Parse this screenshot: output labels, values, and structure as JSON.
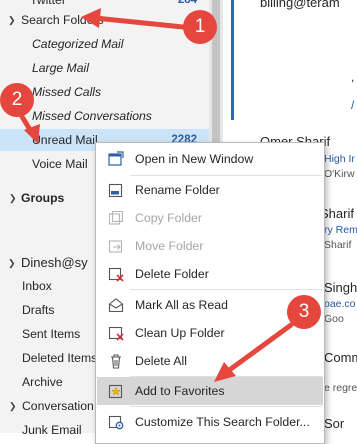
{
  "sidebar": {
    "top_partial": "Twitter",
    "top_partial_count": "284",
    "search_folders": "Search Folders",
    "categorized_mail": "Categorized Mail",
    "large_mail": "Large Mail",
    "missed_calls": "Missed Calls",
    "missed_conversations": "Missed Conversations",
    "unread_mail": "Unread Mail",
    "unread_count": "2282",
    "voice_mail": "Voice Mail",
    "groups": "Groups",
    "account": "Dinesh@sy",
    "inbox": "Inbox",
    "drafts": "Drafts",
    "sent_items": "Sent Items",
    "deleted_items": "Deleted Items",
    "archive": "Archive",
    "conversation": "Conversation",
    "junk_email": "Junk Email"
  },
  "message_list": {
    "email_partial": "billing@teram",
    "sender1": "Omer Sharif",
    "sender1_line2": "High Ir",
    "sender1_line3": "O'Kirw",
    "sender2": "Sharif",
    "sender2_line2": "ry Remi",
    "sender2_line3": "Sharif",
    "sender3": "Singh",
    "sender3_line2": "oae.co",
    "sender3_line3": "Goo",
    "commu": "Commu",
    "regret": "e regret",
    "last": "Sor"
  },
  "context_menu": {
    "items": [
      {
        "label": "Open in New Window",
        "icon": "open-window-icon",
        "disabled": false
      },
      {
        "label": "Rename Folder",
        "icon": "rename-folder-icon",
        "disabled": false
      },
      {
        "label": "Copy Folder",
        "icon": "copy-folder-icon",
        "disabled": true
      },
      {
        "label": "Move Folder",
        "icon": "move-folder-icon",
        "disabled": true
      },
      {
        "label": "Delete Folder",
        "icon": "delete-folder-icon",
        "disabled": false
      },
      {
        "label": "Mark All as Read",
        "icon": "mark-read-icon",
        "disabled": false
      },
      {
        "label": "Clean Up Folder",
        "icon": "clean-up-icon",
        "disabled": false
      },
      {
        "label": "Delete All",
        "icon": "delete-all-icon",
        "disabled": false
      },
      {
        "label": "Add to Favorites",
        "icon": "favorites-star-icon",
        "disabled": false
      },
      {
        "label": "Customize This Search Folder...",
        "icon": "customize-gear-icon",
        "disabled": false
      }
    ]
  },
  "annotations": {
    "step1": "1",
    "step2": "2",
    "step3": "3"
  },
  "colors": {
    "badge": "#e5463d",
    "selection": "#cce4f7",
    "menu_highlight": "#d6d6d6",
    "accent": "#2b6cb0"
  }
}
